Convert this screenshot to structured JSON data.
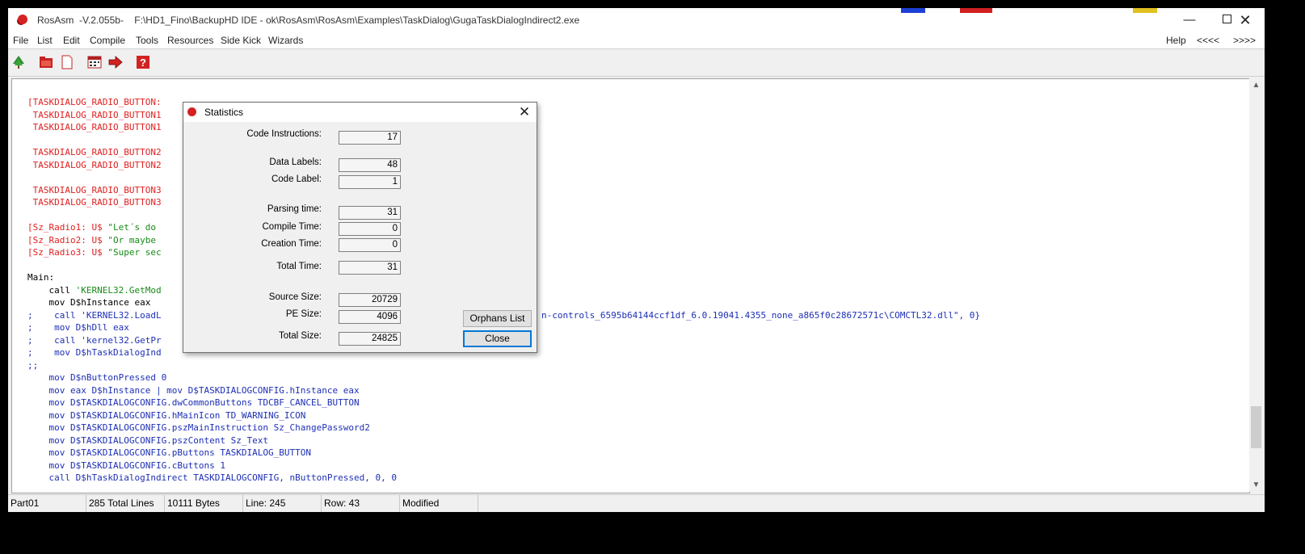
{
  "window": {
    "title": "RosAsm  -V.2.055b-    F:\\HD1_Fino\\BackupHD IDE - ok\\RosAsm\\RosAsm\\Examples\\TaskDialog\\GugaTaskDialogIndirect2.exe",
    "controls": {
      "minimize": "—",
      "maximize": "",
      "close": "✕"
    }
  },
  "menu": {
    "items": [
      "File",
      "List",
      "Edit",
      "Compile",
      "Tools",
      "Resources",
      "Side Kick",
      "Wizards"
    ],
    "right_items": [
      "Help",
      "<<<<",
      ">>>>"
    ]
  },
  "toolbar": {
    "icons": [
      "tree-icon",
      "folder-icon",
      "new-file-icon",
      "calendar-icon",
      "arrow-right-icon",
      "help-icon"
    ]
  },
  "editor": {
    "lines": [
      {
        "text": "[TASKDIALOG_RADIO_BUTTON:",
        "color": "red"
      },
      {
        "text": " TASKDIALOG_RADIO_BUTTON1",
        "color": "red"
      },
      {
        "text": " TASKDIALOG_RADIO_BUTTON1",
        "color": "red"
      },
      {
        "text": "",
        "color": "black"
      },
      {
        "text": " TASKDIALOG_RADIO_BUTTON2",
        "color": "red"
      },
      {
        "text": " TASKDIALOG_RADIO_BUTTON2",
        "color": "red"
      },
      {
        "text": "",
        "color": "black"
      },
      {
        "text": " TASKDIALOG_RADIO_BUTTON3",
        "color": "red"
      },
      {
        "text": " TASKDIALOG_RADIO_BUTTON3",
        "color": "red"
      },
      {
        "text": "",
        "color": "black"
      },
      {
        "text": "[Sz_Radio1: U$ ",
        "color": "red",
        "rest": "\"Let´s do",
        "rest_color": "green"
      },
      {
        "text": "[Sz_Radio2: U$ ",
        "color": "red",
        "rest": "\"Or maybe",
        "rest_color": "green"
      },
      {
        "text": "[Sz_Radio3: U$ ",
        "color": "red",
        "rest": "\"Super sec",
        "rest_color": "green"
      },
      {
        "text": "",
        "color": "black"
      },
      {
        "text": "Main:",
        "color": "black"
      },
      {
        "text": "    call ",
        "color": "black",
        "rest": "'KERNEL32.GetMod",
        "rest_color": "green"
      },
      {
        "text": "    mov D$hInstance eax",
        "color": "black"
      },
      {
        "text": ";    call 'KERNEL32.LoadL",
        "color": "blue",
        "far": "n-controls_6595b64144ccf1df_6.0.19041.4355_none_a865f0c28672571c\\COMCTL32.dll\", 0}"
      },
      {
        "text": ";    mov D$hDll eax",
        "color": "blue"
      },
      {
        "text": ";    call 'kernel32.GetPr",
        "color": "blue"
      },
      {
        "text": ";    mov D$hTaskDialogInd",
        "color": "blue"
      },
      {
        "text": ";;",
        "color": "blue"
      },
      {
        "text": "    mov D$nButtonPressed 0",
        "color": "blue"
      },
      {
        "text": "    mov eax D$hInstance | mov D$TASKDIALOGCONFIG.hInstance eax",
        "color": "blue"
      },
      {
        "text": "    mov D$TASKDIALOGCONFIG.dwCommonButtons TDCBF_CANCEL_BUTTON",
        "color": "blue"
      },
      {
        "text": "    mov D$TASKDIALOGCONFIG.hMainIcon TD_WARNING_ICON",
        "color": "blue"
      },
      {
        "text": "    mov D$TASKDIALOGCONFIG.pszMainInstruction Sz_ChangePassword2",
        "color": "blue"
      },
      {
        "text": "    mov D$TASKDIALOGCONFIG.pszContent Sz_Text",
        "color": "blue"
      },
      {
        "text": "    mov D$TASKDIALOGCONFIG.pButtons TASKDIALOG_BUTTON",
        "color": "blue"
      },
      {
        "text": "    mov D$TASKDIALOGCONFIG.cButtons 1",
        "color": "blue"
      },
      {
        "text": "    call D$hTaskDialogIndirect TASKDIALOGCONFIG, nButtonPressed, 0, 0",
        "color": "blue"
      }
    ]
  },
  "statusbar": {
    "cells": [
      "Part01",
      "285 Total Lines",
      "10111 Bytes",
      "Line: 245",
      "Row: 43",
      "Modified"
    ]
  },
  "dialog": {
    "title": "Statistics",
    "close": "✕",
    "stats": [
      {
        "label": "Code Instructions:",
        "value": "17"
      },
      {
        "label": "Data Labels:",
        "value": "48"
      },
      {
        "label": "Code Label:",
        "value": "1"
      },
      {
        "label": "Parsing time:",
        "value": "31"
      },
      {
        "label": "Compile Time:",
        "value": "0"
      },
      {
        "label": "Creation Time:",
        "value": "0"
      },
      {
        "label": "Total Time:",
        "value": "31"
      },
      {
        "label": "Source Size:",
        "value": "20729"
      },
      {
        "label": "PE Size:",
        "value": "4096"
      },
      {
        "label": "Total Size:",
        "value": "24825"
      }
    ],
    "orphans_button": "Orphans List",
    "close_button": "Close"
  },
  "colors": {
    "code_red": "#e02020",
    "code_blue": "#1d2fb5",
    "code_green": "#178a17",
    "app_icon": "#d32222",
    "default_button_border": "#0078d7"
  }
}
